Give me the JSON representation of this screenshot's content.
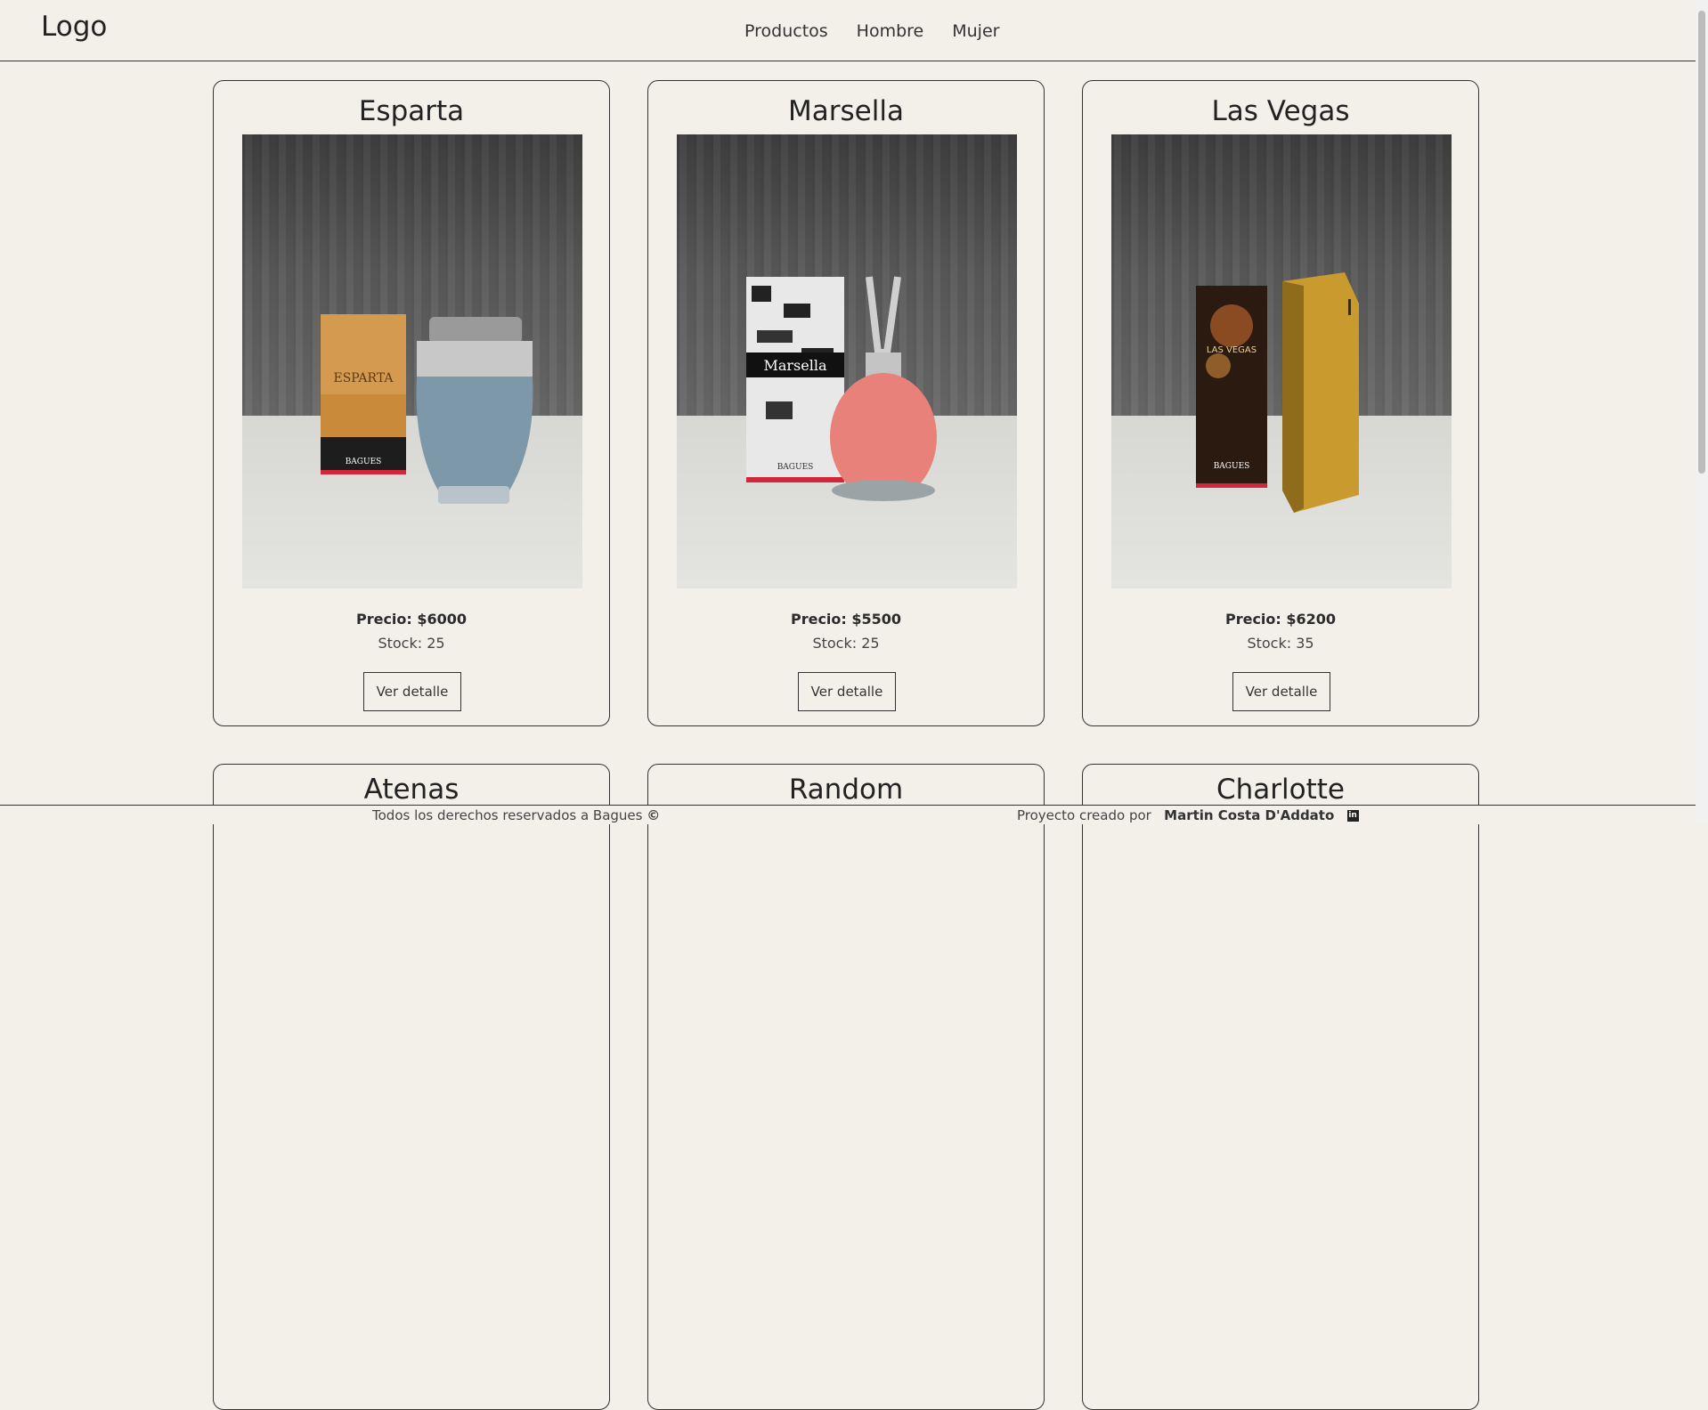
{
  "nav": {
    "logo": "Logo",
    "links": [
      "Productos",
      "Hombre",
      "Mujer"
    ]
  },
  "products": [
    {
      "name": "Esparta",
      "price": "Precio: $6000",
      "stock": "Stock: 25",
      "button": "Ver detalle",
      "box_text": "ESPARTA",
      "brand": "BAGUES"
    },
    {
      "name": "Marsella",
      "price": "Precio: $5500",
      "stock": "Stock: 25",
      "button": "Ver detalle",
      "box_text": "Marsella",
      "brand": "BAGUES"
    },
    {
      "name": "Las Vegas",
      "price": "Precio: $6200",
      "stock": "Stock: 35",
      "button": "Ver detalle",
      "box_text": "LAS VEGAS",
      "brand": "BAGUES"
    },
    {
      "name": "Atenas"
    },
    {
      "name": "Random"
    },
    {
      "name": "Charlotte"
    }
  ],
  "footer": {
    "rights": "Todos los derechos reservados a Bagues",
    "created_by_label": "Proyecto creado por",
    "author": "Martin Costa D'Addato"
  }
}
